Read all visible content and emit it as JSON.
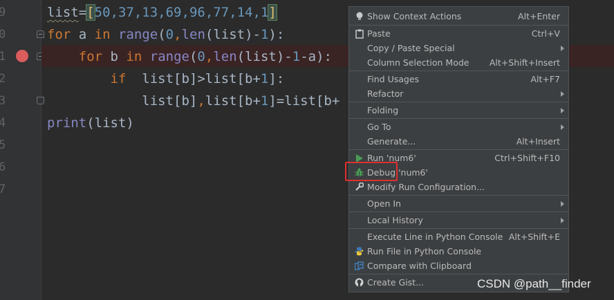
{
  "gutter": {
    "line_numbers": [
      "9",
      "0",
      "1",
      "2",
      "3",
      "4",
      "5",
      "6",
      "7"
    ]
  },
  "code": {
    "line1": {
      "var": "list",
      "eq": "=",
      "open": "[",
      "nums": "50,37,13,69,96,77,14,1",
      "close": "]"
    },
    "line2": {
      "kw_for": "for",
      "var": " a ",
      "kw_in": "in",
      "sp": " ",
      "range": "range",
      "rest": "(",
      "n0": "0",
      "comma": ",",
      "len": "len",
      "args": "(list)-",
      "n1": "1",
      "tail": "):"
    },
    "line3": {
      "indent": "    ",
      "kw_for": "for",
      "var": " b ",
      "kw_in": "in",
      "sp": " ",
      "range": "range",
      "rest": "(",
      "n0": "0",
      "comma": ",",
      "len": "len",
      "args": "(list)-",
      "n1": "1",
      "tail": "-a):"
    },
    "line4": {
      "indent": "        ",
      "kw_if": "if",
      "rest": "  list[b]>list[b+",
      "n1": "1",
      "tail": "]:"
    },
    "line5": {
      "indent": "            ",
      "a": "list[b]",
      "comma": ",",
      "b": "list[b+",
      "n1": "1",
      "c": "]=list[b+"
    },
    "line6": {
      "print": "print",
      "rest": "(list)"
    }
  },
  "context_menu": {
    "show_context_actions": {
      "label": "Show Context Actions",
      "shortcut": "Alt+Enter"
    },
    "paste": {
      "label": "Paste",
      "shortcut": "Ctrl+V"
    },
    "copy_paste_special": {
      "label": "Copy / Paste Special"
    },
    "column_selection_mode": {
      "label": "Column Selection Mode",
      "shortcut": "Alt+Shift+Insert"
    },
    "find_usages": {
      "label": "Find Usages",
      "shortcut": "Alt+F7"
    },
    "refactor": {
      "label": "Refactor"
    },
    "folding": {
      "label": "Folding"
    },
    "go_to": {
      "label": "Go To"
    },
    "generate": {
      "label": "Generate...",
      "shortcut": "Alt+Insert"
    },
    "run": {
      "label": "Run 'num6'",
      "shortcut": "Ctrl+Shift+F10"
    },
    "debug": {
      "label": "Debug 'num6'"
    },
    "modify_run_config": {
      "label": "Modify Run Configuration..."
    },
    "open_in": {
      "label": "Open In"
    },
    "local_history": {
      "label": "Local History"
    },
    "execute_line": {
      "label": "Execute Line in Python Console",
      "shortcut": "Alt+Shift+E"
    },
    "run_file_console": {
      "label": "Run File in Python Console"
    },
    "compare_clipboard": {
      "label": "Compare with Clipboard"
    },
    "create_gist": {
      "label": "Create Gist..."
    }
  },
  "watermark": "CSDN @path__finder",
  "colors": {
    "editor_bg": "#2b2b2b",
    "gutter_bg": "#313335",
    "menu_bg": "#3c3f41",
    "keyword": "#cc7832",
    "number": "#6897bb",
    "builtin": "#8888c6",
    "breakpoint": "#db5c5c",
    "run_icon": "#499c54",
    "highlight_box": "#e03030"
  }
}
